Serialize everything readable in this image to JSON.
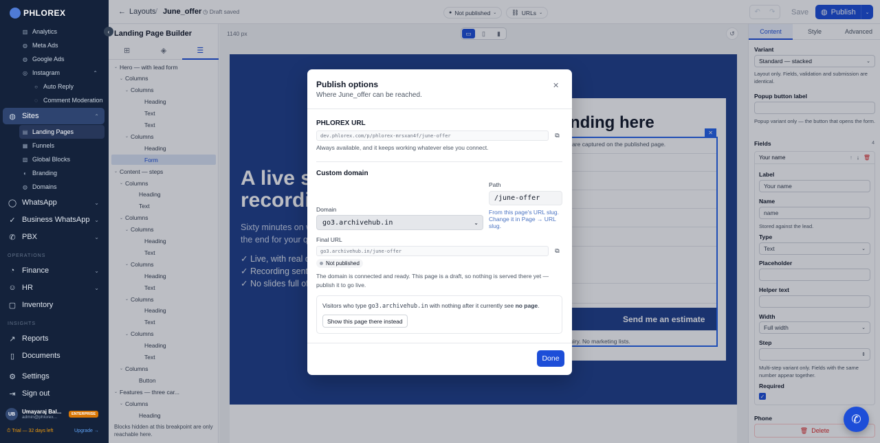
{
  "brand": {
    "logo_text": "PHLOREX"
  },
  "sidebar": {
    "marketing_items": [
      {
        "label": "Analytics",
        "icon": "bar-chart-icon"
      },
      {
        "label": "Meta Ads",
        "icon": "globe-icon"
      },
      {
        "label": "Google Ads",
        "icon": "globe-icon"
      },
      {
        "label": "Instagram",
        "icon": "instagram-icon"
      }
    ],
    "instagram_children": [
      {
        "label": "Auto Reply"
      },
      {
        "label": "Comment Moderation"
      }
    ],
    "sites": {
      "label": "Sites"
    },
    "sites_children": [
      {
        "label": "Landing Pages"
      },
      {
        "label": "Funnels"
      },
      {
        "label": "Global Blocks"
      },
      {
        "label": "Branding"
      },
      {
        "label": "Domains"
      }
    ],
    "whatsapp": {
      "label": "WhatsApp"
    },
    "business_whatsapp": {
      "label": "Business WhatsApp"
    },
    "pbx": {
      "label": "PBX"
    },
    "operations_label": "OPERATIONS",
    "finance": {
      "label": "Finance"
    },
    "hr": {
      "label": "HR"
    },
    "inventory": {
      "label": "Inventory"
    },
    "insights_label": "INSIGHTS",
    "reports": {
      "label": "Reports"
    },
    "documents": {
      "label": "Documents"
    },
    "settings": {
      "label": "Settings"
    },
    "signout": {
      "label": "Sign out"
    },
    "user": {
      "initials": "UB",
      "name": "Umayaraj Bal...",
      "email": "admin@phlorex...",
      "plan": "ENTERPRISE"
    },
    "trial": "⏱ Trial — 32 days left",
    "upgrade": "Upgrade →"
  },
  "topbar": {
    "back_label": "Layouts",
    "page_name": "June_offer",
    "draft_status": "Draft saved",
    "publish_state": "Not published",
    "urls_label": "URLs",
    "save_label": "Save",
    "publish_label": "Publish"
  },
  "tree": {
    "title": "Landing Page Builder",
    "rows": [
      {
        "label": "Hero — with lead form",
        "depth": 0,
        "tw": "⌄"
      },
      {
        "label": "Columns",
        "depth": 1,
        "tw": "⌄"
      },
      {
        "label": "Columns",
        "depth": 2,
        "tw": "⌄"
      },
      {
        "label": "Heading",
        "depth": 3,
        "tw": ""
      },
      {
        "label": "Text",
        "depth": 3,
        "tw": ""
      },
      {
        "label": "Text",
        "depth": 3,
        "tw": ""
      },
      {
        "label": "Columns",
        "depth": 2,
        "tw": "⌄"
      },
      {
        "label": "Heading",
        "depth": 3,
        "tw": ""
      },
      {
        "label": "Form",
        "depth": 3,
        "tw": "",
        "selected": true
      },
      {
        "label": "Content — steps",
        "depth": 0,
        "tw": "⌄"
      },
      {
        "label": "Columns",
        "depth": 1,
        "tw": "⌄"
      },
      {
        "label": "Heading",
        "depth": 2,
        "tw": ""
      },
      {
        "label": "Text",
        "depth": 2,
        "tw": ""
      },
      {
        "label": "Columns",
        "depth": 1,
        "tw": "⌄"
      },
      {
        "label": "Columns",
        "depth": 2,
        "tw": "⌄"
      },
      {
        "label": "Heading",
        "depth": 3,
        "tw": ""
      },
      {
        "label": "Text",
        "depth": 3,
        "tw": ""
      },
      {
        "label": "Columns",
        "depth": 2,
        "tw": "⌄"
      },
      {
        "label": "Heading",
        "depth": 3,
        "tw": ""
      },
      {
        "label": "Text",
        "depth": 3,
        "tw": ""
      },
      {
        "label": "Columns",
        "depth": 2,
        "tw": "⌄"
      },
      {
        "label": "Heading",
        "depth": 3,
        "tw": ""
      },
      {
        "label": "Text",
        "depth": 3,
        "tw": ""
      },
      {
        "label": "Columns",
        "depth": 2,
        "tw": "⌄"
      },
      {
        "label": "Heading",
        "depth": 3,
        "tw": ""
      },
      {
        "label": "Text",
        "depth": 3,
        "tw": ""
      },
      {
        "label": "Columns",
        "depth": 1,
        "tw": "⌄"
      },
      {
        "label": "Button",
        "depth": 2,
        "tw": ""
      },
      {
        "label": "Features — three car...",
        "depth": 0,
        "tw": "⌄"
      },
      {
        "label": "Columns",
        "depth": 1,
        "tw": "⌄"
      },
      {
        "label": "Heading",
        "depth": 2,
        "tw": ""
      }
    ],
    "footer": "Blocks hidden at this breakpoint are only reachable here."
  },
  "canvas": {
    "width_label": "1140 px",
    "hero_heading": "A live se... recordi...",
    "hero_heading_l1": "A live se",
    "hero_heading_l2": "recordi",
    "hero_para_l1": "Sixty minutes on w",
    "hero_para_l2": "the end for your qu",
    "hero_list": [
      "✓ Live, with real qu",
      "✓ Recording sent w",
      "✓ No slides full of s"
    ],
    "form_heading": "nding here",
    "form_note": "ons are captured on the published page.",
    "form_fine": "nly to discuss this enquiry. No marketing lists.",
    "form_button": "Send me an estimate",
    "rupee_note": "(₹)"
  },
  "inspector": {
    "tabs": [
      "Content",
      "Style",
      "Advanced"
    ],
    "variant_label": "Variant",
    "variant_value": "Standard — stacked",
    "variant_help": "Layout only. Fields, validation and submission are identical.",
    "popup_label": "Popup button label",
    "popup_help": "Popup variant only — the button that opens the form.",
    "fields_label": "Fields",
    "fields_count": "4",
    "field_title": "Your name",
    "label_lab": "Label",
    "label_val": "Your name",
    "name_lab": "Name",
    "name_val": "name",
    "name_help": "Stored against the lead.",
    "type_lab": "Type",
    "type_val": "Text",
    "placeholder_lab": "Placeholder",
    "helper_lab": "Helper text",
    "width_lab": "Width",
    "width_val": "Full width",
    "step_lab": "Step",
    "step_help": "Multi-step variant only. Fields with the same number appear together.",
    "required_lab": "Required",
    "phone_lab": "Phone",
    "delete_label": "Delete"
  },
  "modal": {
    "title": "Publish options",
    "subtitle_pre": "Where ",
    "subtitle_name": "June_offer",
    "subtitle_post": " can be reached.",
    "phlorex_url_label": "PHLOREX URL",
    "phlorex_url": "dev.phlorex.com/p/phlorex-mrsxan4f/june-offer",
    "phlorex_help": "Always available, and it keeps working whatever else you connect.",
    "custom_domain_label": "Custom domain",
    "path_label": "Path",
    "path_value": "/june-offer",
    "path_help": "From this page's URL slug. Change it in Page → URL slug.",
    "domain_label": "Domain",
    "domain_value": "go3.archivehub.in",
    "final_url_label": "Final URL",
    "final_url": "go3.archivehub.in/june-offer",
    "status_badge": "Not published",
    "status_help": "The domain is connected and ready. This page is a draft, so nothing is served there yet — publish it to go live.",
    "visitors_pre": "Visitors who type ",
    "visitors_domain": "go3.archivehub.in",
    "visitors_mid": " with nothing after it currently see ",
    "visitors_bold": "no page",
    "visitors_post": ".",
    "show_button": "Show this page there instead",
    "done_label": "Done"
  },
  "colors": {
    "primary": "#1d4ed8",
    "sidebar": "#14223b",
    "hero": "#1f3f8a"
  }
}
